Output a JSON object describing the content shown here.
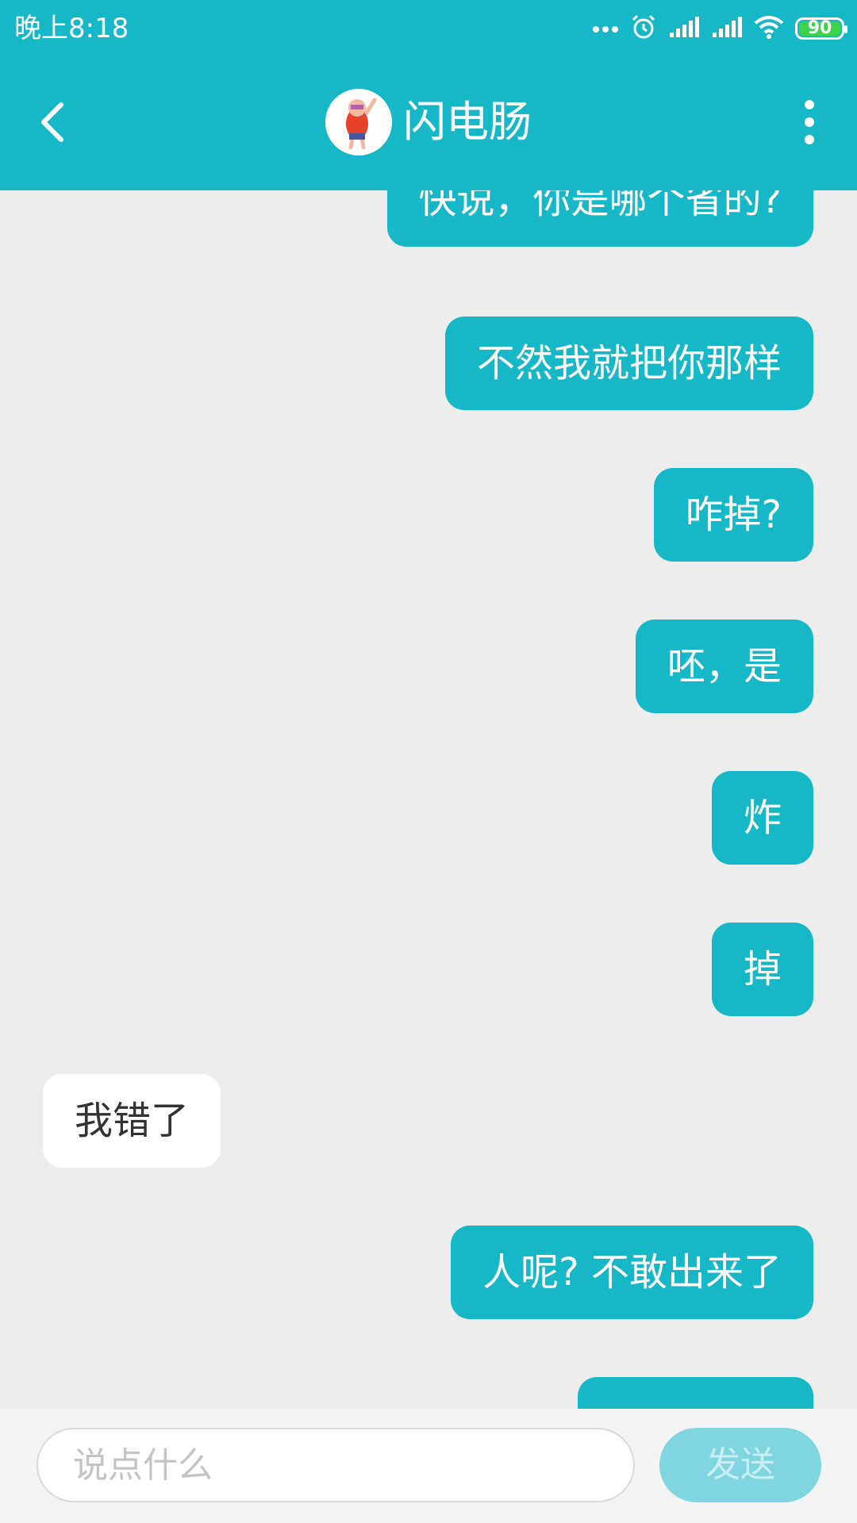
{
  "status_bar": {
    "time": "晚上8:18",
    "battery": "90",
    "icons": [
      "more-dots-icon",
      "alarm-icon",
      "signal-icon",
      "signal-icon",
      "wifi-icon",
      "battery-icon"
    ]
  },
  "header": {
    "title": "闪电肠",
    "back_icon": "chevron-left-icon",
    "more_icon": "more-vertical-icon"
  },
  "messages": [
    {
      "side": "sent",
      "text": "快说，你是哪个省的?"
    },
    {
      "side": "sent",
      "text": "不然我就把你那样"
    },
    {
      "side": "sent",
      "text": "咋掉?"
    },
    {
      "side": "sent",
      "text": "呸，是"
    },
    {
      "side": "sent",
      "text": "炸"
    },
    {
      "side": "sent",
      "text": "掉"
    },
    {
      "side": "recv",
      "text": "我错了"
    },
    {
      "side": "sent",
      "text": "人呢? 不敢出来了"
    }
  ],
  "input": {
    "placeholder": "说点什么",
    "value": ""
  },
  "send_label": "发送",
  "colors": {
    "accent": "#16b8c8",
    "send_disabled": "#7fd6df",
    "chat_bg": "#ededed"
  }
}
